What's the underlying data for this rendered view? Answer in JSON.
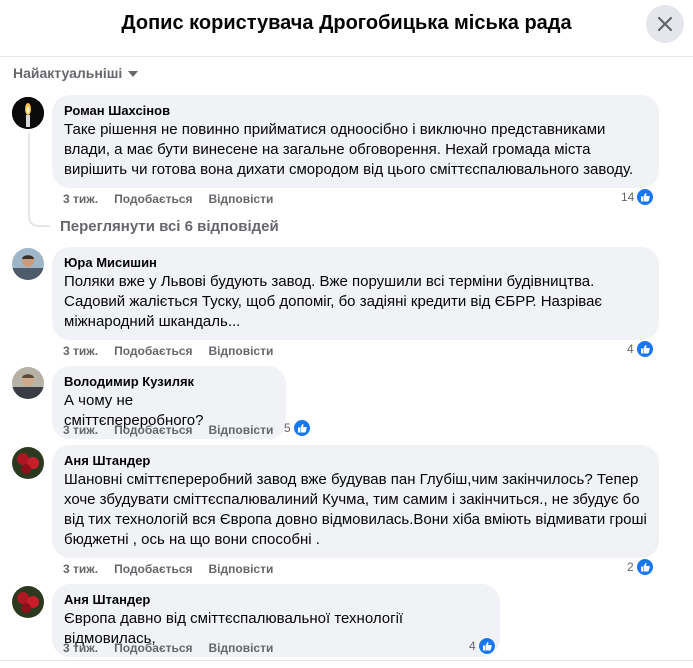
{
  "header": {
    "title": "Допис користувача Дрогобицька міська рада"
  },
  "sort": {
    "label": "Найактуальніші"
  },
  "comments": [
    {
      "author": "Роман Шахсінов",
      "text": "Таке рішення не повинно прийматися одноосібно і виключно представниками влади, а має бути винесене на загальне обговорення. Нехай громада міста вирішить чи готова вона дихати смородом від цього сміттєспалювального заводу.",
      "time": "3 тиж.",
      "like": "Подобається",
      "reply": "Відповісти",
      "reactions": "14",
      "view_replies": "Переглянути всі 6 відповідей"
    },
    {
      "author": "Юра Мисишин",
      "text": "Поляки вже у Львові будують завод. Вже порушили всі терміни будівництва. Садовий жаліється Туску, щоб допоміг, бо задіяні кредити від ЄБРР. Назріває міжнародний шкандаль...",
      "time": "3 тиж.",
      "like": "Подобається",
      "reply": "Відповісти",
      "reactions": "4"
    },
    {
      "author": "Володимир Кузиляк",
      "text": "А чому не сміттєпереробного?",
      "time": "3 тиж.",
      "like": "Подобається",
      "reply": "Відповісти",
      "reactions": "5"
    },
    {
      "author": "Аня Штандер",
      "text": "Шановні сміттєпереробний завод вже будував пан Глубіш,чим закінчилось? Тепер хоче збудувати сміттєспалювалиний Кучма, тим самим і закінчиться., не збудує бо від тих технологій вся Європа довно відмовилась.Вони хіба вміють відмивати гроші бюджетні , ось на що вони способні .",
      "time": "3 тиж.",
      "like": "Подобається",
      "reply": "Відповісти",
      "reactions": "2"
    },
    {
      "author": "Аня Штандер",
      "text": "Європа давно від сміттєспалювальної технології відмовилась,",
      "time": "3 тиж.",
      "like": "Подобається",
      "reply": "Відповісти",
      "reactions": "4"
    }
  ]
}
